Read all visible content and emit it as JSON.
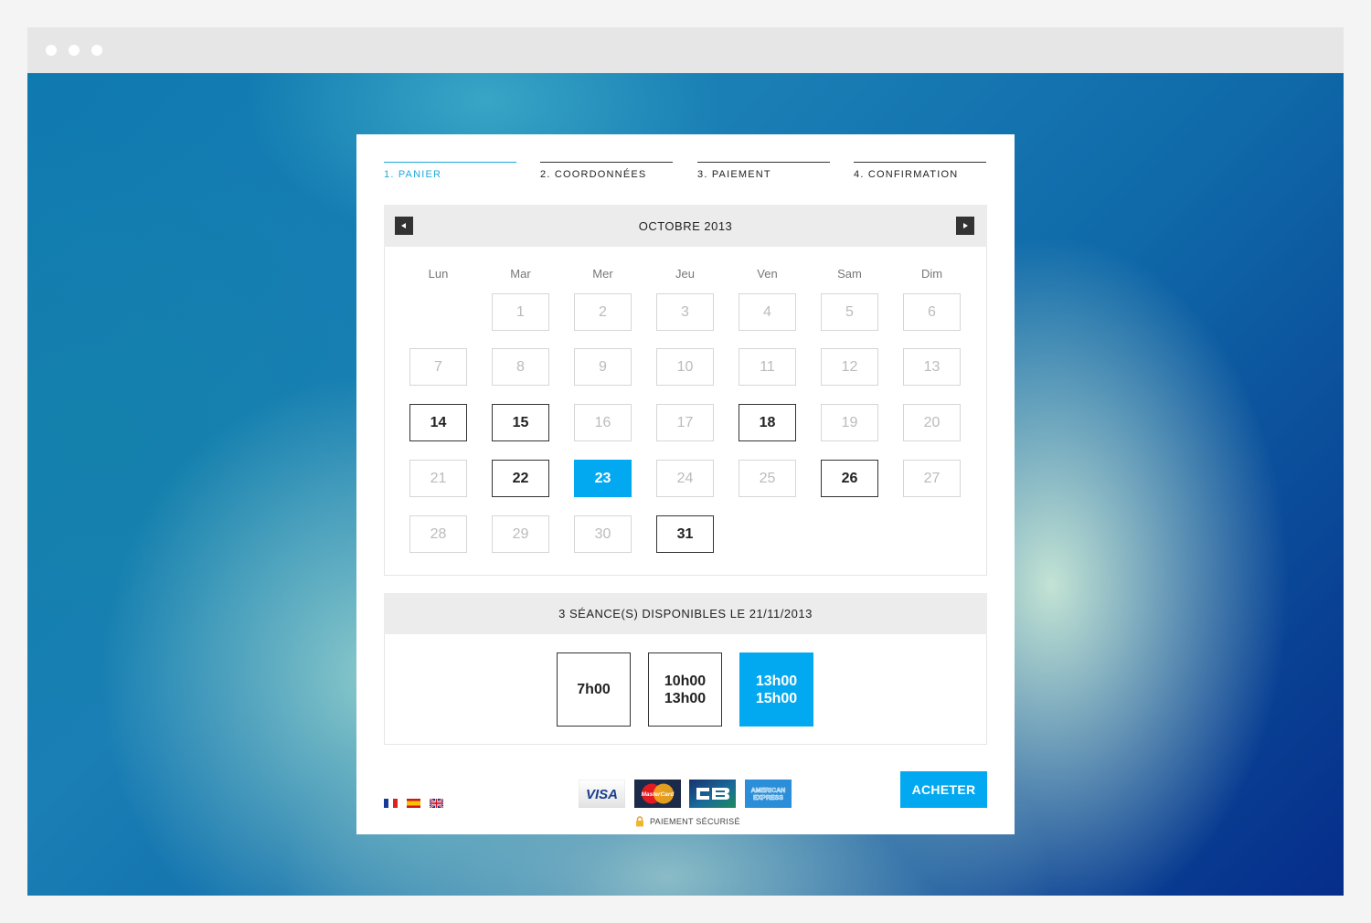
{
  "steps": [
    {
      "label": "1. PANIER",
      "active": true
    },
    {
      "label": "2. COORDONNÉES",
      "active": false
    },
    {
      "label": "3. PAIEMENT",
      "active": false
    },
    {
      "label": "4. CONFIRMATION",
      "active": false
    }
  ],
  "calendar": {
    "month_label": "OCTOBRE 2013",
    "prev_icon": "triangle-left-icon",
    "next_icon": "triangle-right-icon",
    "weekdays": [
      "Lun",
      "Mar",
      "Mer",
      "Jeu",
      "Ven",
      "Sam",
      "Dim"
    ],
    "first_weekday_offset": 1,
    "days_in_month": 31,
    "available_days": [
      14,
      15,
      18,
      22,
      26,
      31
    ],
    "selected_day": 23
  },
  "sessions": {
    "header": "3 SÉANCE(S) DISPONIBLES LE 21/11/2013",
    "slots": [
      {
        "lines": [
          "7h00"
        ],
        "selected": false
      },
      {
        "lines": [
          "10h00",
          "13h00"
        ],
        "selected": false
      },
      {
        "lines": [
          "13h00",
          "15h00"
        ],
        "selected": true
      }
    ]
  },
  "footer": {
    "languages": [
      "flag-fr-icon",
      "flag-es-icon",
      "flag-gb-icon"
    ],
    "payment_logos": [
      "visa-logo",
      "mastercard-logo",
      "cb-logo",
      "american-express-logo"
    ],
    "visa_text": "VISA",
    "mastercard_text": "MasterCard",
    "amex_text_1": "AMERICAN",
    "amex_text_2": "EXPRESS",
    "secure_label": "PAIEMENT SÉCURISÉ",
    "buy_label": "ACHETER"
  },
  "colors": {
    "accent": "#03a9f0",
    "step_active": "#1fa8dc",
    "header_bg": "#ececec",
    "text_dark": "#222222"
  }
}
